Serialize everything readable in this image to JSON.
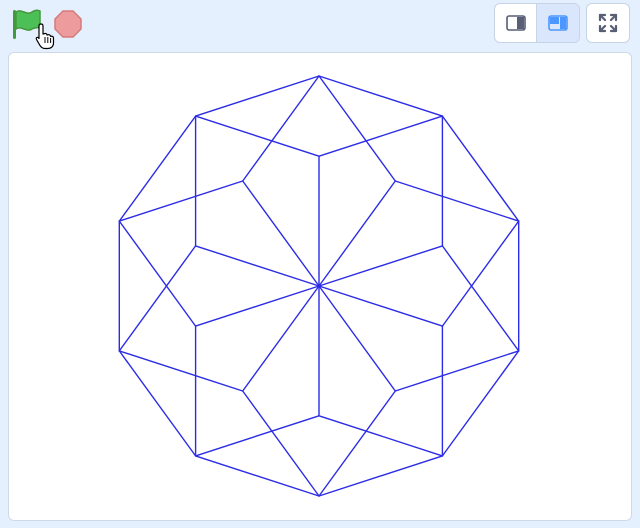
{
  "toolbar": {
    "green_flag": {
      "icon": "green-flag-icon",
      "color": "#4cbf56"
    },
    "stop": {
      "icon": "stop-sign-icon",
      "color": "#ec9c9c"
    },
    "stage_modes": [
      {
        "mode": "small-stage",
        "icon": "small-stage-icon",
        "active": false
      },
      {
        "mode": "normal-stage",
        "icon": "normal-stage-icon",
        "active": true
      }
    ],
    "fullscreen": {
      "icon": "fullscreen-icon"
    }
  },
  "stage": {
    "drawing": {
      "shape": "decagon rosette of rhombi",
      "pen_color": "#2c2ce6",
      "points": 10
    }
  },
  "colors": {
    "background": "#e5f0ff",
    "accent": "#4c97ff",
    "stage": "#ffffff"
  }
}
